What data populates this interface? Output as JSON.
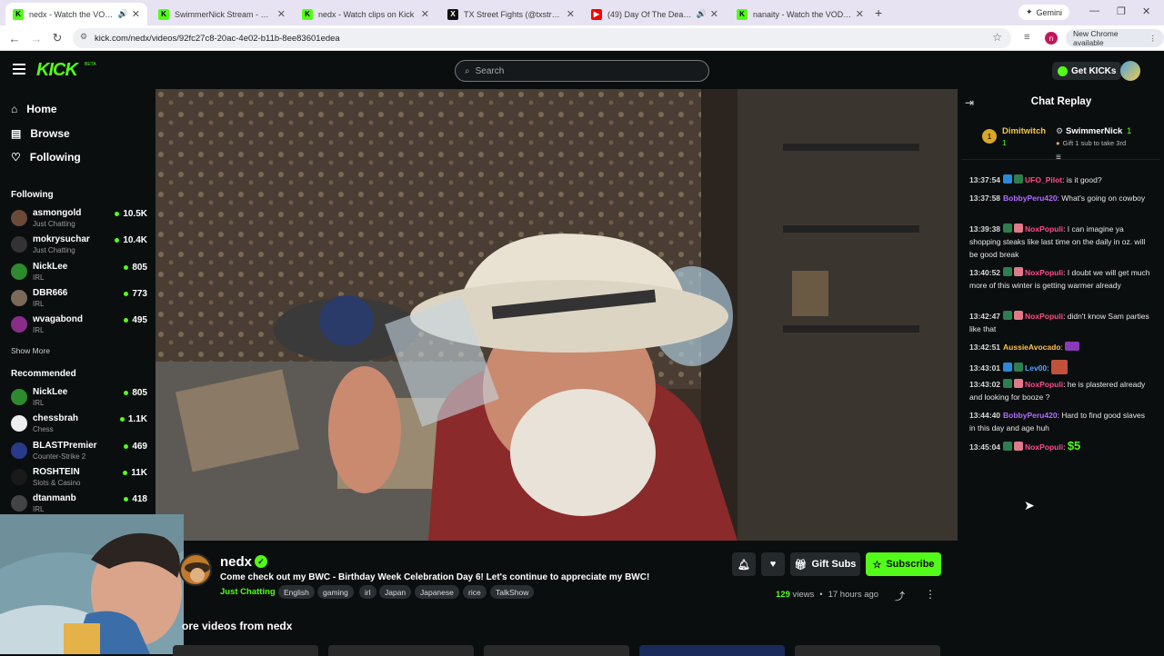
{
  "browser": {
    "tabs": [
      {
        "title": "nedx - Watch the VOD on K",
        "favicon": "K",
        "color": "#53fc18",
        "active": true
      },
      {
        "title": "SwimmerNick Stream - Watch L",
        "favicon": "K",
        "color": "#53fc18",
        "active": false
      },
      {
        "title": "nedx - Watch clips on Kick",
        "favicon": "K",
        "color": "#53fc18",
        "active": false
      },
      {
        "title": "TX Street Fights (@txstreetfight",
        "favicon": "X",
        "color": "#111111",
        "active": false
      },
      {
        "title": "(49) Day Of The Dead Sour",
        "favicon": "▶",
        "color": "#ff0000",
        "active": false
      },
      {
        "title": "nanaity - Watch the VOD on Ki",
        "favicon": "K",
        "color": "#53fc18",
        "active": false
      }
    ],
    "gemini_label": "Gemini",
    "url": "kick.com/nedx/videos/92fc27c8-20ac-4e02-b11b-8ee83601edea",
    "new_chrome_label": "New Chrome available"
  },
  "header": {
    "logo": "KICK",
    "beta": "BETA",
    "search_placeholder": "Search",
    "get_kicks": "Get KICKs"
  },
  "sidebar": {
    "nav": [
      {
        "label": "Home",
        "icon": "home-icon"
      },
      {
        "label": "Browse",
        "icon": "browse-icon"
      },
      {
        "label": "Following",
        "icon": "heart-icon"
      }
    ],
    "following_heading": "Following",
    "following": [
      {
        "name": "asmongold",
        "category": "Just Chatting",
        "viewers": "10.5K",
        "color": "#6b4a3a"
      },
      {
        "name": "mokrysuchar",
        "category": "Just Chatting",
        "viewers": "10.4K",
        "color": "#333333"
      },
      {
        "name": "NickLee",
        "category": "IRL",
        "viewers": "805",
        "color": "#2d8a2d"
      },
      {
        "name": "DBR666",
        "category": "IRL",
        "viewers": "773",
        "color": "#7a6a5a"
      },
      {
        "name": "wvagabond",
        "category": "IRL",
        "viewers": "495",
        "color": "#8a2d8a"
      }
    ],
    "show_more": "Show More",
    "recommended_heading": "Recommended",
    "recommended": [
      {
        "name": "NickLee",
        "category": "IRL",
        "viewers": "805",
        "color": "#2d8a2d"
      },
      {
        "name": "chessbrah",
        "category": "Chess",
        "viewers": "1.1K",
        "color": "#eeeeee"
      },
      {
        "name": "BLASTPremier",
        "category": "Counter-Strike 2",
        "viewers": "469",
        "color": "#2a3a8a"
      },
      {
        "name": "ROSHTEIN",
        "category": "Slots & Casino",
        "viewers": "11K",
        "color": "#1a1a1a"
      },
      {
        "name": "dtanmanb",
        "category": "IRL",
        "viewers": "418",
        "color": "#444444"
      }
    ]
  },
  "video_info": {
    "channel": "nedx",
    "title": "Come check out my BWC - Birthday Week Celebration Day 6! Let's continue to appreciate my BWC!",
    "category": "Just Chatting",
    "tags": [
      "English",
      "gaming",
      "irl",
      "Japan",
      "Japanese",
      "rice",
      "TalkShow"
    ],
    "gift_subs": "Gift Subs",
    "subscribe": "Subscribe",
    "views_count": "129",
    "views_label": "views",
    "separator": "•",
    "time_ago": "17 hours ago",
    "more_videos": "ore videos from nedx"
  },
  "chat": {
    "title": "Chat Replay",
    "pinned": {
      "gifter": "Dimitwitch",
      "gifter_count": "1",
      "recipient": "SwimmerNick",
      "recipient_count": "1",
      "note": "Gift 1 sub to take 3rd"
    },
    "messages": [
      {
        "time": "13:37:54",
        "user": "UFO_Pilot",
        "color": "#ff4d88",
        "text": ": is it good?"
      },
      {
        "time": "13:37:58",
        "user": "BobbyPeru420",
        "color": "#b36bff",
        "text": ": What's going on cowboy"
      },
      {
        "time": "13:39:38",
        "user": "NoxPopuli",
        "color": "#ff4d88",
        "text": ": I can imagine ya shopping steaks like last time on the daily in oz. will be good break"
      },
      {
        "time": "13:40:52",
        "user": "NoxPopuli",
        "color": "#ff4d88",
        "text": ": I doubt we will get much more of this winter is getting warmer already"
      },
      {
        "time": "13:42:47",
        "user": "NoxPopuli",
        "color": "#ff4d88",
        "text": ": didn't know Sam parties like that"
      },
      {
        "time": "13:42:51",
        "user": "AussieAvocado",
        "color": "#ffc04d",
        "text": ":"
      },
      {
        "time": "13:43:01",
        "user": "Lev00",
        "color": "#5aa0ff",
        "text": ":"
      },
      {
        "time": "13:43:02",
        "user": "NoxPopuli",
        "color": "#ff4d88",
        "text": ": he is plastered already and looking for booze ?"
      },
      {
        "time": "13:44:40",
        "user": "BobbyPeru420",
        "color": "#b36bff",
        "text": ": Hard to find good slaves in this day and age huh"
      },
      {
        "time": "13:45:04",
        "user": "NoxPopuli",
        "color": "#ff4d88",
        "text": ":"
      }
    ],
    "tip_amount": "$5"
  }
}
